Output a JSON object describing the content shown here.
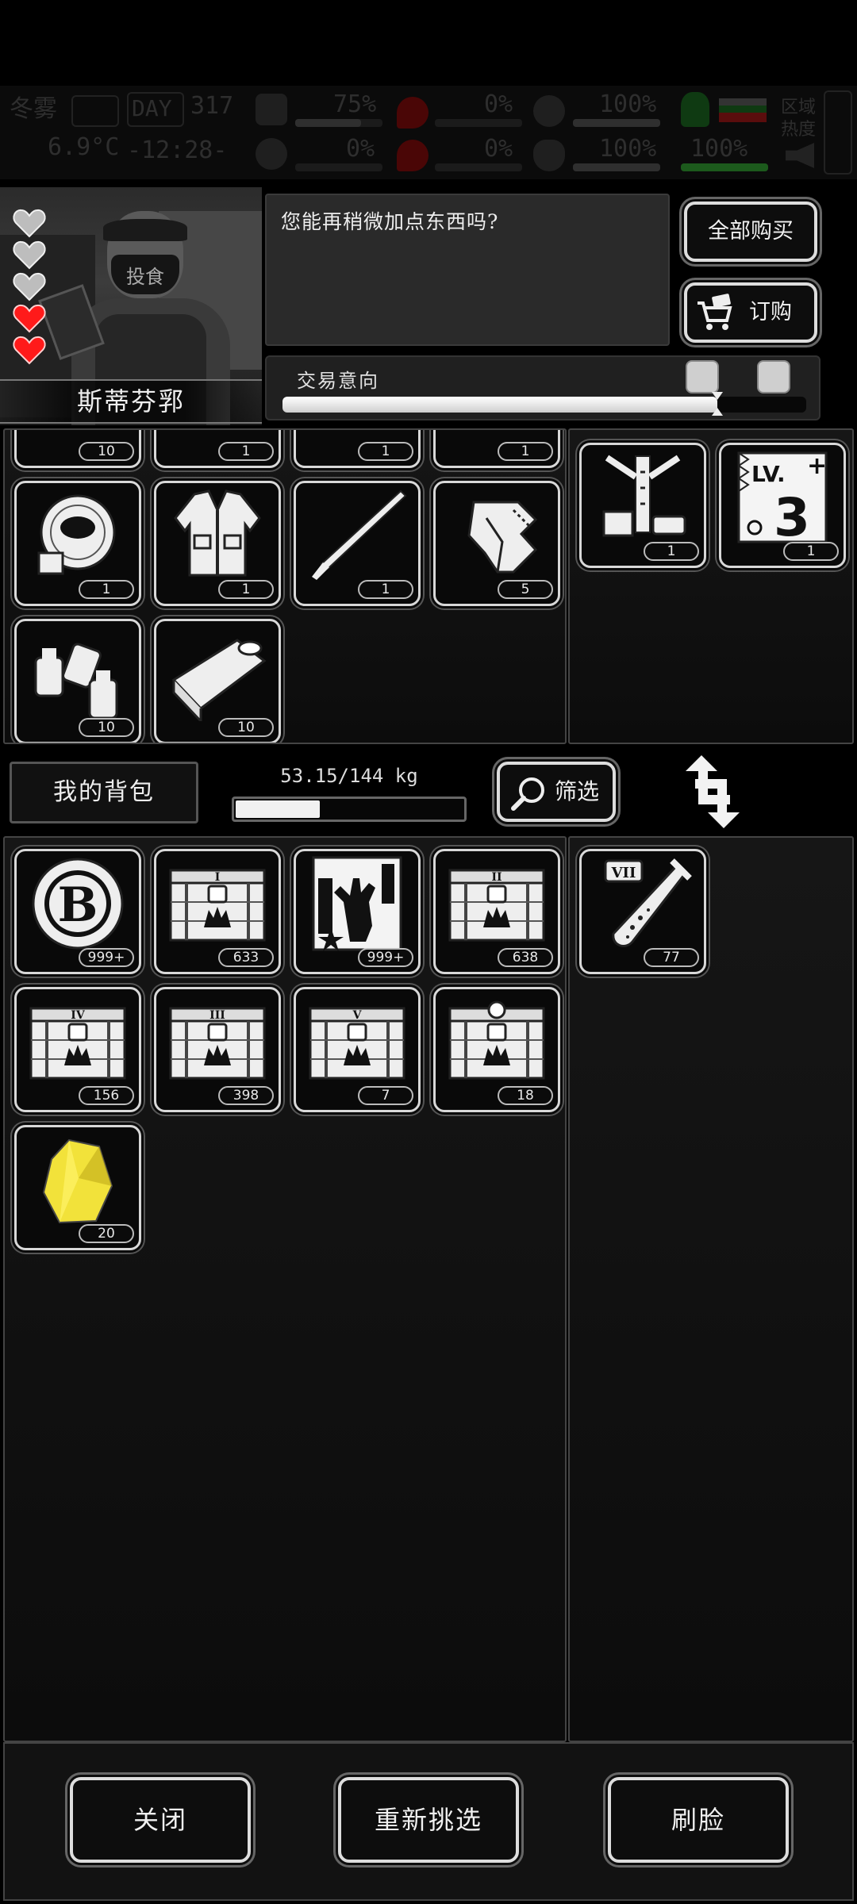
{
  "hud": {
    "season": "冬雾",
    "day_label": "DAY",
    "day_number": "317",
    "temperature": "6.9°C",
    "time": "-12:28-",
    "stats": [
      {
        "name": "health",
        "value": "75%",
        "fill": 0.75
      },
      {
        "name": "bleeding",
        "value": "0%",
        "fill": 0
      },
      {
        "name": "armor",
        "value": "100%",
        "fill": 1
      },
      {
        "name": "energy",
        "value": "0%",
        "fill": 0
      },
      {
        "name": "blood",
        "value": "0%",
        "fill": 0
      },
      {
        "name": "mood",
        "value": "100%",
        "fill": 1
      },
      {
        "name": "region",
        "value": "100%",
        "fill": 1
      }
    ],
    "region_heat_label": "区域热度"
  },
  "trader": {
    "name": "斯蒂芬郛",
    "mask_text": "投食",
    "hearts_total": 5,
    "hearts_filled": 2,
    "dialog": "您能再稍微加点东西吗?",
    "buy_all_label": "全部购买",
    "order_label": "订购",
    "deal_label": "交易意向",
    "deal_value": 0.83
  },
  "trader_inventory": {
    "items": [
      {
        "icon": "item-partial-icon",
        "count": "10"
      },
      {
        "icon": "item-partial-icon",
        "count": "1"
      },
      {
        "icon": "item-partial-icon",
        "count": "1"
      },
      {
        "icon": "item-partial-icon",
        "count": "1"
      },
      {
        "icon": "tape-roll-icon",
        "count": "1"
      },
      {
        "icon": "jacket-icon",
        "count": "1"
      },
      {
        "icon": "blade-icon",
        "count": "1"
      },
      {
        "icon": "bandage-roll-icon",
        "count": "5"
      },
      {
        "icon": "spray-bottles-icon",
        "count": "10"
      },
      {
        "icon": "canned-food-icon",
        "count": "10"
      }
    ],
    "side_items": [
      {
        "icon": "workbench-tool-icon",
        "count": "1"
      },
      {
        "icon": "level-3-blueprint-icon",
        "count": "1",
        "level_text": "LV.",
        "level_num": "3"
      }
    ]
  },
  "backpack": {
    "tab_label": "我的背包",
    "weight_text": "53.15/144 kg",
    "weight_fill": 0.369,
    "filter_label": "筛选",
    "items": [
      {
        "icon": "b-coin-icon",
        "count": "999+",
        "coin_letter": "B"
      },
      {
        "icon": "crate-tier-1-icon",
        "count": "633",
        "tier": "I"
      },
      {
        "icon": "zombie-card-icon",
        "count": "999+"
      },
      {
        "icon": "crate-tier-2-icon",
        "count": "638",
        "tier": "II"
      },
      {
        "icon": "crate-tier-4-icon",
        "count": "156",
        "tier": "IV"
      },
      {
        "icon": "crate-tier-3-icon",
        "count": "398",
        "tier": "III"
      },
      {
        "icon": "crate-tier-5-icon",
        "count": "7",
        "tier": "V"
      },
      {
        "icon": "crate-special-icon",
        "count": "18",
        "tier": "?"
      },
      {
        "icon": "gold-crystal-icon",
        "count": "20"
      }
    ],
    "side_items": [
      {
        "icon": "test-tube-vii-icon",
        "count": "77",
        "tier": "VII"
      }
    ]
  },
  "footer": {
    "close_label": "关闭",
    "reselect_label": "重新挑选",
    "refresh_label": "刷脸"
  },
  "colors": {
    "heart_filled": "#ff1a1a",
    "heart_empty": "#bdbdbd",
    "crystal": "#f2e23a"
  }
}
